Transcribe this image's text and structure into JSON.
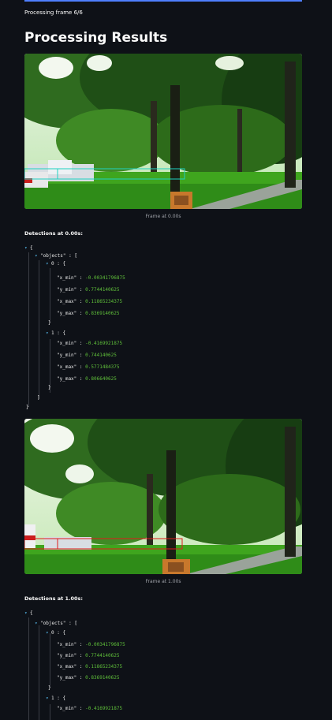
{
  "status_text": "Processing frame 6/6",
  "page_title": "Processing Results",
  "results": [
    {
      "caption": "Frame at 0.00s",
      "detections_title": "Detections at 0.00s:",
      "objects_key": "\"objects\"",
      "objects": [
        {
          "index": "0",
          "x_min": "-0.00341796875",
          "y_min": "0.7744140625",
          "x_max": "0.11865234375",
          "y_max": "0.8369140625"
        },
        {
          "index": "1",
          "x_min": "-0.4169921875",
          "y_min": "0.744140625",
          "x_max": "0.5771484375",
          "y_max": "0.806640625"
        }
      ]
    },
    {
      "caption": "Frame at 1.00s",
      "detections_title": "Detections at 1.00s:",
      "objects_key": "\"objects\"",
      "objects": [
        {
          "index": "0",
          "x_min": "-0.00341796875",
          "y_min": "0.7744140625",
          "x_max": "0.11865234375",
          "y_max": "0.8369140625"
        },
        {
          "index": "1",
          "x_min": "-0.4169921875"
        }
      ]
    }
  ],
  "json_keys": {
    "x_min": "\"x_min\"",
    "y_min": "\"y_min\"",
    "x_max": "\"x_max\"",
    "y_max": "\"y_max\""
  },
  "colors": {
    "background": "#0e1117",
    "progress": "#4f7fff",
    "number": "#5fbf3a",
    "caret": "#4ea9d6",
    "box_frame1": "#1fd1c1",
    "box_frame2": "#e01b1b"
  }
}
